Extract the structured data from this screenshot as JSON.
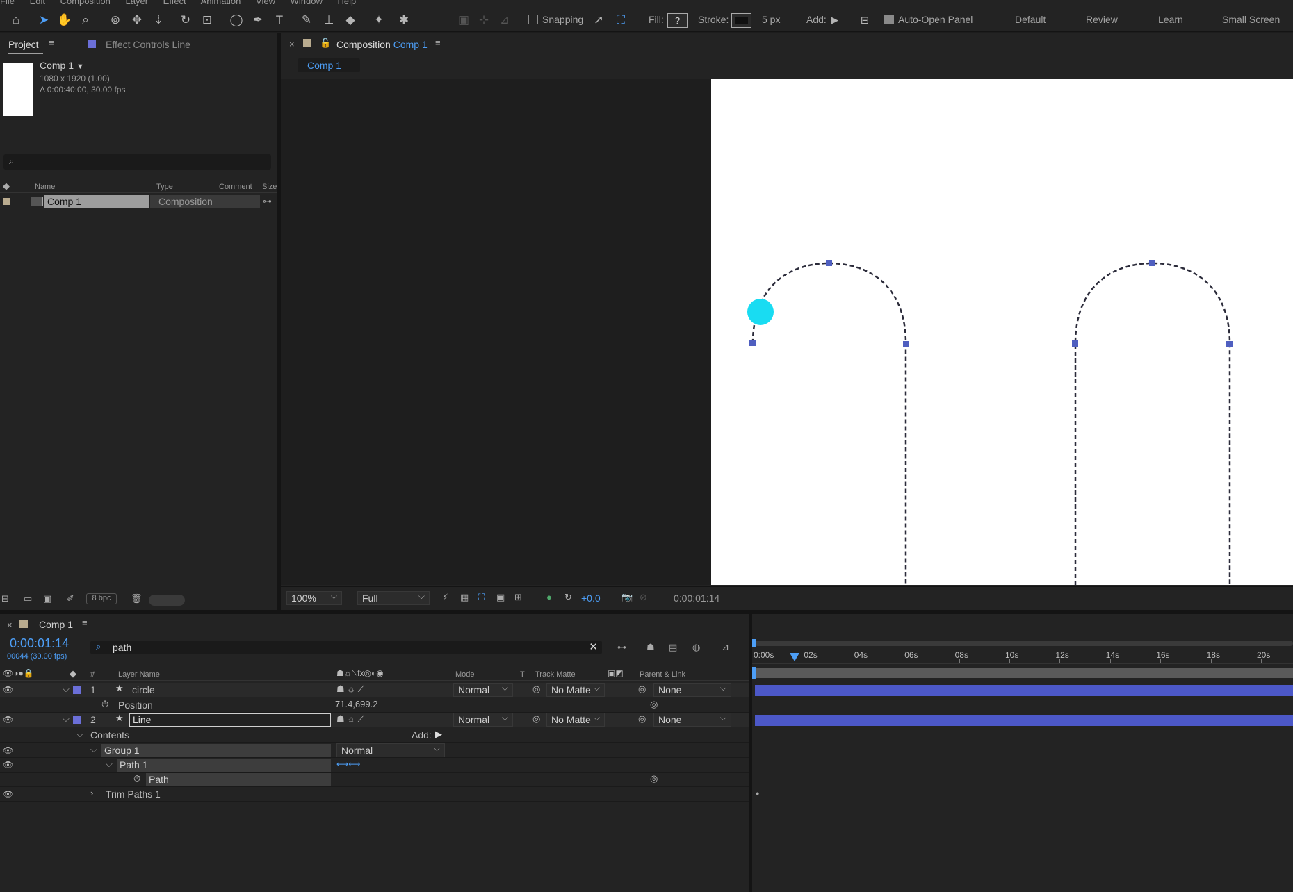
{
  "menubar": [
    "File",
    "Edit",
    "Composition",
    "Layer",
    "Effect",
    "Animation",
    "View",
    "Window",
    "Help"
  ],
  "toolbar": {
    "snapping_label": "Snapping",
    "fill_label": "Fill:",
    "fill_value": "?",
    "stroke_label": "Stroke:",
    "stroke_width": "5 px",
    "add_label": "Add:",
    "auto_open_label": "Auto-Open Panel",
    "workspaces": [
      "Default",
      "Review",
      "Learn",
      "Small Screen"
    ]
  },
  "project": {
    "tab_project": "Project",
    "tab_effect_controls": "Effect Controls Line",
    "comp_name": "Comp 1",
    "comp_res": "1080 x 1920 (1.00)",
    "comp_duration": "Δ 0:00:40:00, 30.00 fps",
    "columns": {
      "name": "Name",
      "type": "Type",
      "comment": "Comment",
      "size": "Size"
    },
    "items": [
      {
        "name": "Comp 1",
        "type": "Composition"
      }
    ],
    "bpc": "8 bpc"
  },
  "viewer": {
    "tab_prefix": "Composition",
    "tab_comp": "Comp 1",
    "breadcrumb": "Comp 1",
    "zoom": "100%",
    "resolution": "Full",
    "exposure": "+0.0",
    "timecode": "0:00:01:14"
  },
  "timeline": {
    "tab_label": "Comp 1",
    "timecode": "0:00:01:14",
    "frame_info": "00044 (30.00 fps)",
    "search_value": "path",
    "col_num": "#",
    "col_layer_name": "Layer Name",
    "col_mode": "Mode",
    "col_t": "T",
    "col_track_matte": "Track Matte",
    "col_parent": "Parent & Link",
    "layers": [
      {
        "num": "1",
        "name": "circle",
        "mode": "Normal",
        "matte": "No Matte",
        "parent": "None"
      },
      {
        "num": "2",
        "name": "Line",
        "mode": "Normal",
        "matte": "No Matte",
        "parent": "None"
      }
    ],
    "position_label": "Position",
    "position_value": "71.4,699.2",
    "contents_label": "Contents",
    "add_label": "Add:",
    "group_label": "Group 1",
    "group_mode": "Normal",
    "path1_label": "Path 1",
    "path_label": "Path",
    "trim_label": "Trim Paths 1",
    "ruler": [
      "0:00s",
      "02s",
      "04s",
      "06s",
      "08s",
      "10s",
      "12s",
      "14s",
      "16s",
      "18s",
      "20s"
    ],
    "playhead_sec": 1.47
  }
}
